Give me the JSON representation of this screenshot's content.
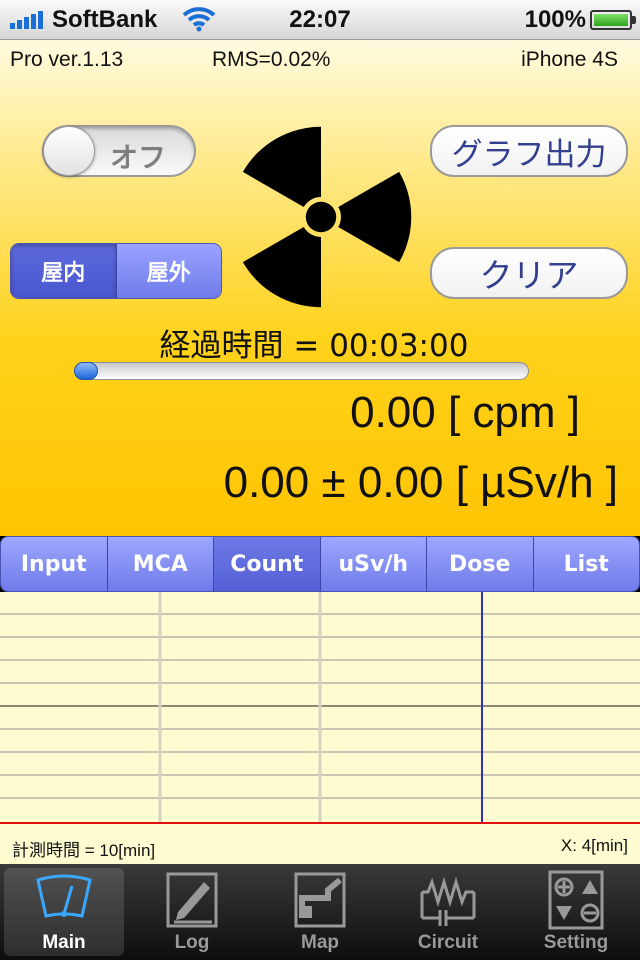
{
  "status_bar": {
    "carrier": "SoftBank",
    "time": "22:07",
    "battery": "100%"
  },
  "info": {
    "version": "Pro ver.1.13",
    "rms": "RMS=0.02%",
    "device": "iPhone 4S"
  },
  "controls": {
    "toggle_label": "オフ",
    "toggle_on": false,
    "location_options": [
      "屋内",
      "屋外"
    ],
    "location_selected": "屋内",
    "graph_output_label": "グラフ出力",
    "clear_label": "クリア"
  },
  "measurement": {
    "elapsed": "経過時間 = 00:03:00",
    "elapsed_fraction": 0.05,
    "cpm": "0.00 [ cpm ]",
    "usvh": "0.00 ± 0.00 [ µSv/h ]"
  },
  "mode_tabs": {
    "items": [
      "Input",
      "MCA",
      "Count",
      "uSv/h",
      "Dose",
      "List"
    ],
    "active": "Count"
  },
  "graph": {
    "measure_time": "計測時間 = 10[min]",
    "x_readout": "X: 4[min]",
    "colors": {
      "background": "#fffbd1",
      "cursor": "#3030c8",
      "baseline": "#e01010"
    }
  },
  "tab_bar": {
    "items": [
      "Main",
      "Log",
      "Map",
      "Circuit",
      "Setting"
    ],
    "active": "Main"
  },
  "colors": {
    "accent": "#6f7bea",
    "panel": "#ffd21c",
    "button_text": "#32408f"
  }
}
